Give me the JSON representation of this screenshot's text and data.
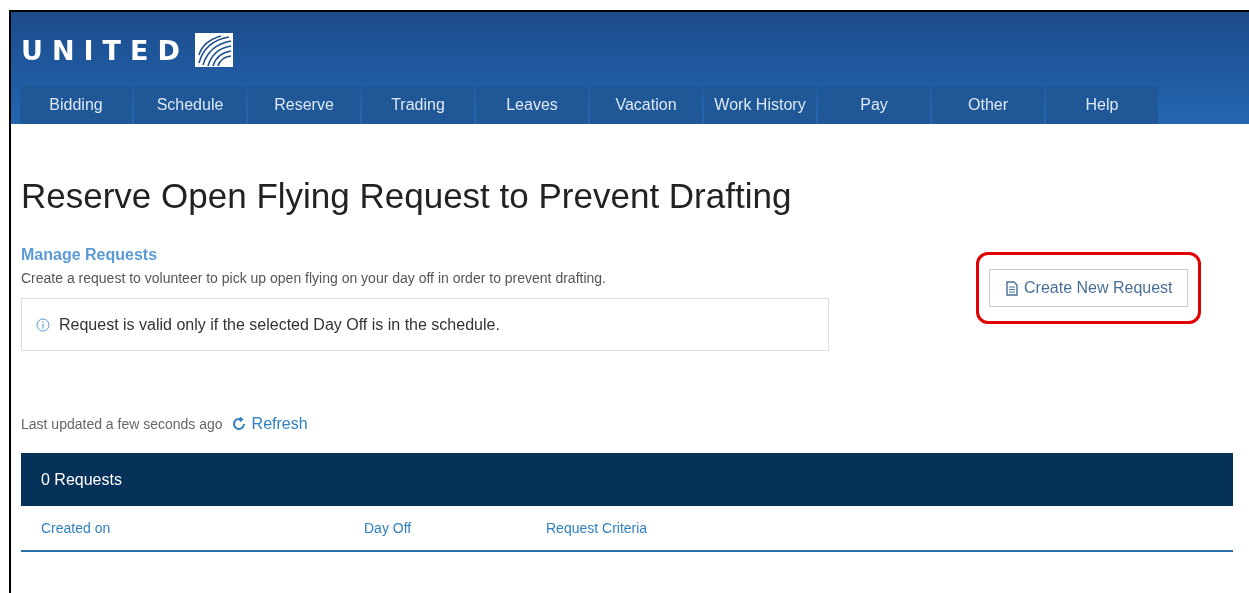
{
  "header": {
    "logo_text": "UNITED"
  },
  "nav": {
    "tabs": [
      {
        "label": "Bidding"
      },
      {
        "label": "Schedule"
      },
      {
        "label": "Reserve"
      },
      {
        "label": "Trading"
      },
      {
        "label": "Leaves"
      },
      {
        "label": "Vacation"
      },
      {
        "label": "Work History"
      },
      {
        "label": "Pay"
      },
      {
        "label": "Other"
      },
      {
        "label": "Help"
      }
    ]
  },
  "page": {
    "title": "Reserve Open Flying Request to Prevent Drafting",
    "section_heading": "Manage Requests",
    "description": "Create a request to volunteer to pick up open flying on your day off in order to prevent drafting.",
    "info_note": "Request is valid only if the selected Day Off is in the schedule.",
    "create_button": "Create New Request",
    "last_updated": "Last updated a few seconds ago",
    "refresh_link": "Refresh"
  },
  "table": {
    "count": "0 Requests",
    "columns": [
      "Created on",
      "Day Off",
      "Request Criteria"
    ]
  }
}
